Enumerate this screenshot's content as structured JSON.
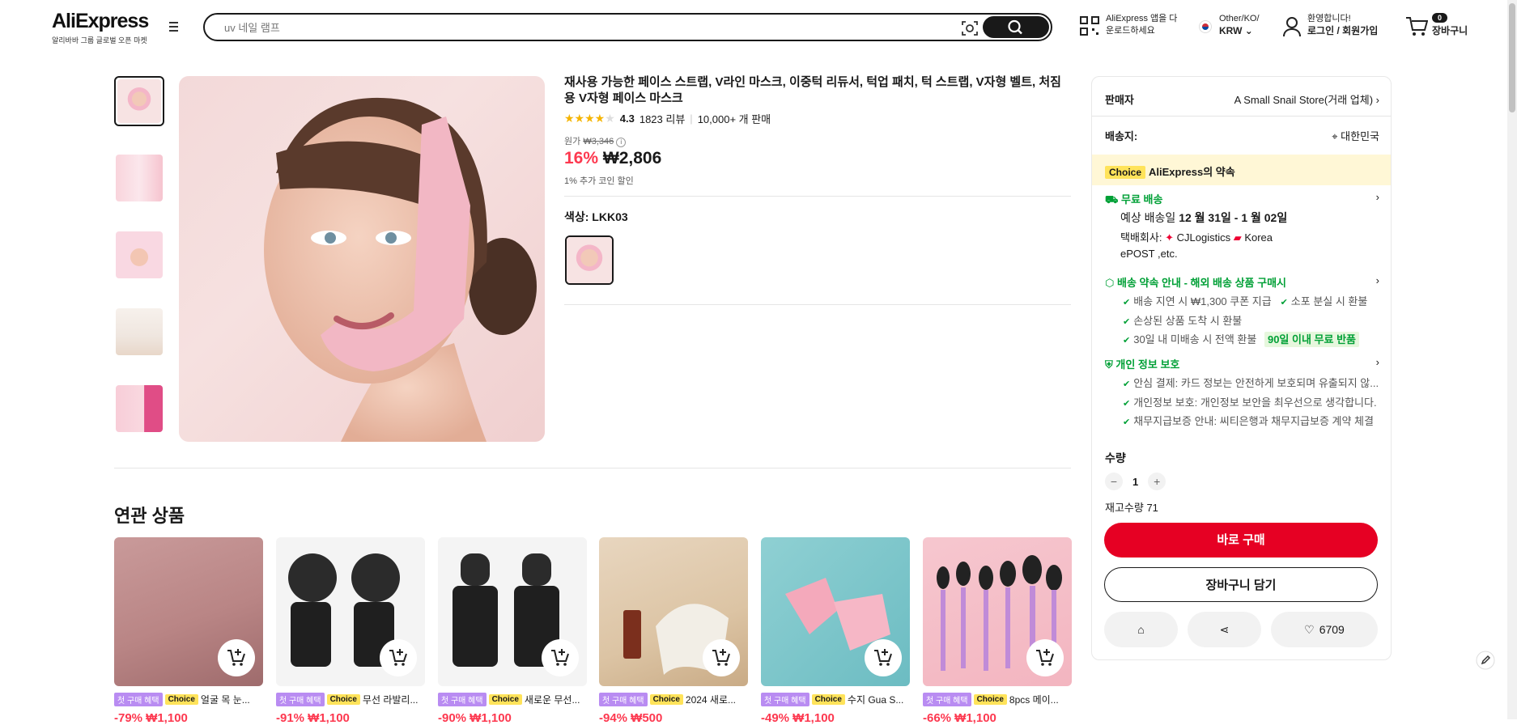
{
  "header": {
    "logo": "AliExpress",
    "logo_sub": "알리바바 그룹 글로벌 오픈 마켓",
    "search_placeholder": "uv 네일 램프",
    "app_line1": "AliExpress 앱을 다",
    "app_line2": "운로드하세요",
    "region_line1": "Other/KO/",
    "region_line2": "KRW",
    "account_line1": "환영합니다!",
    "account_line2": "로그인 / 회원가입",
    "cart_count": "0",
    "cart_label": "장바구니"
  },
  "product": {
    "title": "재사용 가능한 페이스 스트랩, V라인 마스크, 이중턱 리듀서, 턱업 패치, 턱 스트랩, V자형 벨트, 처짐용 V자형 페이스 마스크",
    "rating": "4.3",
    "reviews": "1823 리뷰",
    "sold": "10,000+ 개 판매",
    "orig_label": "원가",
    "orig_price": "₩3,346",
    "discount": "16%",
    "price": "₩2,806",
    "coin": "1% 추가 코인 할인",
    "color_label": "색상: LKK03"
  },
  "related": {
    "title": "연관 상품",
    "tag_first": "첫 구매 혜택",
    "tag_choice": "Choice",
    "items": [
      {
        "name": "얼굴 목 눈...",
        "price": "-79% ₩1,100"
      },
      {
        "name": "무선 라발리...",
        "price": "-91% ₩1,100"
      },
      {
        "name": "새로운 무선...",
        "price": "-90% ₩1,100"
      },
      {
        "name": "2024 새로...",
        "price": "-94% ₩500"
      },
      {
        "name": "수지 Gua S...",
        "price": "-49% ₩1,100"
      },
      {
        "name": "8pcs 메이...",
        "price": "-66% ₩1,100"
      }
    ]
  },
  "panel": {
    "seller_label": "판매자",
    "seller_name": "A Small Snail Store(거래 업체)",
    "ship_label": "배송지:",
    "ship_to": "대한민국",
    "choice_tag": "Choice",
    "choice_promise": "AliExpress의 약속",
    "free_ship": "무료 배송",
    "eta_prefix": "예상 배송일",
    "eta": "12 월 31일 - 1 월 02일",
    "carrier_label": "택배회사:",
    "carrier1": "CJLogistics",
    "carrier2": "Korea",
    "carrier3": "ePOST ,etc.",
    "promise_title": "배송 약속 안내 - 해외 배송 상품 구매시",
    "promise1": "배송 지연 시 ₩1,300 쿠폰 지급",
    "promise2": "소포 분실 시 환불",
    "promise3": "손상된 상품 도착 시 환불",
    "promise4": "30일 내 미배송 시 전액 환불",
    "promise4_badge": "90일 이내 무료 반품",
    "privacy_title": "개인 정보 보호",
    "privacy1": "안심 결제: 카드 정보는 안전하게 보호되며 유출되지 않...",
    "privacy2": "개인정보 보호: 개인정보 보안을 최우선으로 생각합니다.",
    "privacy3": "채무지급보증 안내: 씨티은행과 채무지급보증 계약 체결",
    "qty_label": "수량",
    "qty": "1",
    "stock": "재고수량 71",
    "buy_now": "바로 구매",
    "add_cart": "장바구니 담기",
    "wish_count": "6709"
  }
}
